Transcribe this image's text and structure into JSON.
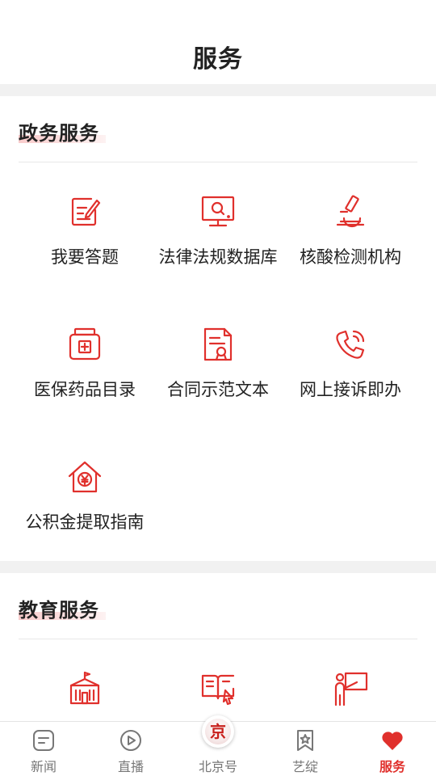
{
  "header": {
    "title": "服务"
  },
  "sections": [
    {
      "title": "政务服务",
      "items": [
        {
          "label": "我要答题",
          "icon": "edit-note-icon"
        },
        {
          "label": "法律法规数据库",
          "icon": "monitor-search-icon"
        },
        {
          "label": "核酸检测机构",
          "icon": "microscope-icon"
        },
        {
          "label": "医保药品目录",
          "icon": "medicine-bottle-icon"
        },
        {
          "label": "合同示范文本",
          "icon": "contract-document-icon"
        },
        {
          "label": "网上接诉即办",
          "icon": "phone-call-icon"
        },
        {
          "label": "公积金提取指南",
          "icon": "house-fund-icon"
        }
      ]
    },
    {
      "title": "教育服务",
      "items": [
        {
          "label": "",
          "icon": "school-building-icon"
        },
        {
          "label": "",
          "icon": "open-book-cursor-icon"
        },
        {
          "label": "",
          "icon": "teacher-board-icon"
        }
      ]
    }
  ],
  "tabbar": {
    "tabs": [
      {
        "label": "新闻",
        "icon": "news-icon",
        "active": false
      },
      {
        "label": "直播",
        "icon": "play-icon",
        "active": false
      },
      {
        "label": "北京号",
        "icon": "beijing-badge-icon",
        "active": false,
        "badge_text": "京"
      },
      {
        "label": "艺绽",
        "icon": "bookmark-star-icon",
        "active": false
      },
      {
        "label": "服务",
        "icon": "heart-icon",
        "active": true
      }
    ]
  },
  "colors": {
    "accent": "#e0302c",
    "divider": "#f1f1f1",
    "text": "#222222",
    "tab_inactive": "#777777"
  }
}
